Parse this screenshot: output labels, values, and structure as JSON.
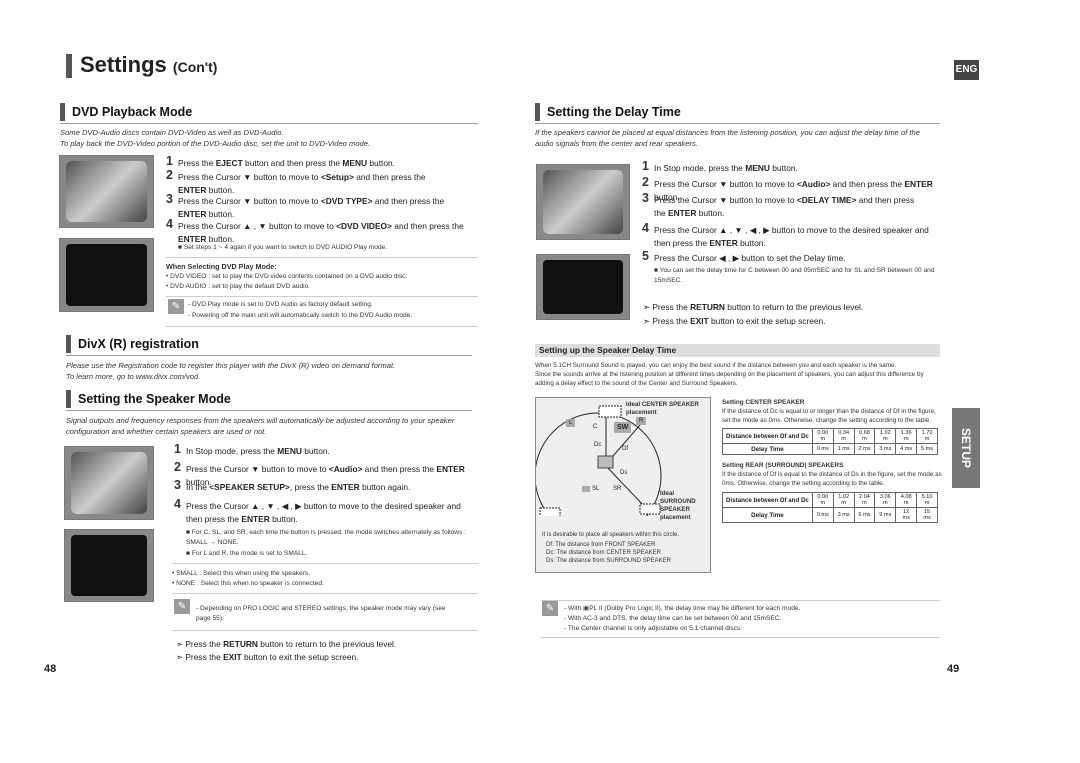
{
  "header": {
    "title": "Settings",
    "title_suffix": "(Con't)",
    "lang_badge": "ENG",
    "side_tab": "SETUP"
  },
  "dvd": {
    "heading": "DVD Playback Mode",
    "intro": [
      "Some DVD-Audio discs contain DVD-Video as well as DVD-Audio.",
      "To play back the DVD-Video portion of the DVD-Audio disc, set the unit to DVD-Video mode."
    ],
    "steps": [
      {
        "n": "1",
        "segs": [
          [
            "Press the ",
            0
          ],
          [
            "EJECT",
            1
          ],
          [
            " button and then press the ",
            0
          ],
          [
            "MENU",
            1
          ],
          [
            " button.",
            0
          ]
        ]
      },
      {
        "n": "2",
        "segs": [
          [
            "Press the Cursor ▼ button to move to ",
            0
          ],
          [
            "<Setup>",
            1
          ],
          [
            " and then press the ",
            0
          ],
          [
            "ENTER",
            1
          ],
          [
            " button.",
            0
          ]
        ]
      },
      {
        "n": "3",
        "segs": [
          [
            "Press the Cursor ▼ button to move to ",
            0
          ],
          [
            "<DVD TYPE>",
            1
          ],
          [
            " and then press the ",
            0
          ],
          [
            "ENTER",
            1
          ],
          [
            " button.",
            0
          ]
        ]
      },
      {
        "n": "4",
        "segs": [
          [
            "Press the Cursor ▲ , ▼ button to move to ",
            0
          ],
          [
            "<DVD VIDEO>",
            1
          ],
          [
            " and then press the ",
            0
          ],
          [
            "ENTER",
            1
          ],
          [
            " button.",
            0
          ]
        ]
      }
    ],
    "step_note": "■  Set steps 1 ~ 4 again if you want to switch to DVD AUDIO Play mode.",
    "select_title": "When Selecting DVD Play Mode:",
    "select_items": [
      "• DVD VIDEO : set to play the DVD video contents contained on a DVD audio disc.",
      "• DVD AUDIO : set to play the default DVD audio."
    ],
    "notes": [
      "- DVD Play mode is set to DVD Audio as factory default setting.",
      "- Powering off the main unit will automatically switch to the DVD Audio mode."
    ]
  },
  "divx": {
    "heading": "DivX (R) registration",
    "intro": [
      "Please use the Registration code to register this player with the DivX (R) video on demand format.",
      "To learn more, go to www.divx.com/vod."
    ]
  },
  "speaker": {
    "heading": "Setting the Speaker Mode",
    "intro": [
      "Signal outputs and frequency responses from the speakers will automatically be adjusted according to your speaker",
      "configuration and whether certain speakers are used or not."
    ],
    "steps": [
      {
        "n": "1",
        "segs": [
          [
            "In Stop mode, press the ",
            0
          ],
          [
            "MENU",
            1
          ],
          [
            " button.",
            0
          ]
        ]
      },
      {
        "n": "2",
        "segs": [
          [
            "Press the Cursor ▼ button to move to ",
            0
          ],
          [
            "<Audio>",
            1
          ],
          [
            " and then press the ",
            0
          ],
          [
            "ENTER",
            1
          ],
          [
            " button.",
            0
          ]
        ]
      },
      {
        "n": "3",
        "segs": [
          [
            "In the ",
            0
          ],
          [
            "<SPEAKER SETUP>",
            1
          ],
          [
            ", press the ",
            0
          ],
          [
            "ENTER",
            1
          ],
          [
            " button again.",
            0
          ]
        ]
      },
      {
        "n": "4",
        "segs": [
          [
            "Press the Cursor ▲ , ▼ , ◀ , ▶ button to move to the desired speaker and then press the ",
            0
          ],
          [
            "ENTER",
            1
          ],
          [
            " button.",
            0
          ]
        ]
      }
    ],
    "step_notes": [
      "■  For C, SL, and SR, each time the button is pressed, the mode switches alternately as follows : SMALL → NONE.",
      "■  For L and R, the mode is set to SMALL."
    ],
    "items": [
      "• SMALL : Select this when using the speakers.",
      "• NONE : Select this when no speaker is connected."
    ],
    "note": "- Depending on PRO LOGIC and STEREO settings, the speaker mode may vary (see page 55).",
    "arrows": [
      [
        [
          "➣  Press the ",
          0
        ],
        [
          "RETURN",
          1
        ],
        [
          " button to return to the previous level.",
          0
        ]
      ],
      [
        [
          "➣  Press the ",
          0
        ],
        [
          "EXIT",
          1
        ],
        [
          " button to exit the setup screen.",
          0
        ]
      ]
    ]
  },
  "delay": {
    "heading": "Setting the Delay Time",
    "intro": "If the speakers cannot be placed at equal distances from the listening position, you can adjust the delay time of the audio signals from the center and rear speakers.",
    "steps": [
      {
        "n": "1",
        "segs": [
          [
            "In Stop mode, press the ",
            0
          ],
          [
            "MENU",
            1
          ],
          [
            " button.",
            0
          ]
        ]
      },
      {
        "n": "2",
        "segs": [
          [
            "Press the Cursor ▼ button to move to ",
            0
          ],
          [
            "<Audio>",
            1
          ],
          [
            " and then press the ",
            0
          ],
          [
            "ENTER",
            1
          ],
          [
            " button.",
            0
          ]
        ]
      },
      {
        "n": "3",
        "segs": [
          [
            "Press the Cursor ▼ button to move to ",
            0
          ],
          [
            "<DELAY TIME>",
            1
          ],
          [
            " and then press the ",
            0
          ],
          [
            "ENTER",
            1
          ],
          [
            " button.",
            0
          ]
        ]
      },
      {
        "n": "4",
        "segs": [
          [
            "Press the Cursor ▲ , ▼ , ◀ , ▶ button to move to the desired speaker and then press the ",
            0
          ],
          [
            "ENTER",
            1
          ],
          [
            " button.",
            0
          ]
        ]
      },
      {
        "n": "5",
        "segs": [
          [
            "Press the Cursor ◀ , ▶ button to set the Delay time.",
            0
          ]
        ]
      }
    ],
    "step_note": "■  You can set the delay time for C between 00 and 05mSEC and for SL and SR between 00 and 15mSEC.",
    "arrows": [
      [
        [
          "➣  Press the ",
          0
        ],
        [
          "RETURN",
          1
        ],
        [
          " button to return to the previous level.",
          0
        ]
      ],
      [
        [
          "➣  Press the ",
          0
        ],
        [
          "EXIT",
          1
        ],
        [
          " button to exit the setup screen.",
          0
        ]
      ]
    ],
    "sub_heading": "Setting up the Speaker Delay Time",
    "sub_intro": [
      "When 5.1CH Surround Sound is played, you can enjoy the best sound if the distance between you and each speaker is the same.",
      "Since the sounds arrive at the listening position at different times depending on the placement of speakers, you can adjust this difference by",
      "adding a delay effect to the sound of the Center and Surround Speakers."
    ],
    "diagram": {
      "center_label": "Ideal CENTER SPEAKER placement",
      "surround_label": [
        "Ideal",
        "SURROUND",
        "SPEAKER",
        "placement"
      ],
      "speakers": [
        "L",
        "C",
        "SW",
        "R",
        "SL",
        "SR"
      ],
      "distances": [
        "Dc",
        "Df",
        "Ds"
      ],
      "caption": "It is desirable to place all speakers within this circle.",
      "legend": [
        "Df: The distance from FRONT SPEAKER",
        "Dc: The distance from CENTER SPEAKER",
        "Ds: The distance from SURROUND SPEAKER"
      ]
    },
    "center": {
      "title": "Setting CENTER SPEAKER",
      "text": "If the distance of Dc is equal to or longer than the distance of Df in the figure, set the mode as 0ms. Otherwise, change the setting according to the table.",
      "row_labels": [
        "Distance between Df and Dc",
        "Delay Time"
      ],
      "distances": [
        "0.00 m",
        "0.34 m",
        "0.68 m",
        "1.02 m",
        "1.36 m",
        "1.70 m"
      ],
      "delays": [
        "0 ms",
        "1 ms",
        "2 ms",
        "3 ms",
        "4 ms",
        "5 ms"
      ]
    },
    "rear": {
      "title": "Setting REAR (SURROUND) SPEAKERS",
      "text": "If the distance of Df is equal to the distance of Ds in the figure, set the mode as 0ms. Otherwise, change the setting according to the table.",
      "row_labels": [
        "Distance between Df and Dc",
        "Delay Time"
      ],
      "distances": [
        "0.00 m",
        "1.02 m",
        "2.04 m",
        "3.06 m",
        "4.08 m",
        "5.10 m"
      ],
      "delays": [
        "0 ms",
        "3 ms",
        "6 ms",
        "9 ms",
        "12 ms",
        "15 ms"
      ]
    },
    "notes": [
      "- With ▣PL II (Dolby Pro Logic II), the delay time may be different for each mode.",
      "- With AC-3 and DTS, the delay time can be set between 00 and 15mSEC.",
      "- The Center channel is only adjustable on 5.1 channel discs."
    ]
  },
  "pages": {
    "left": "48",
    "right": "49"
  }
}
